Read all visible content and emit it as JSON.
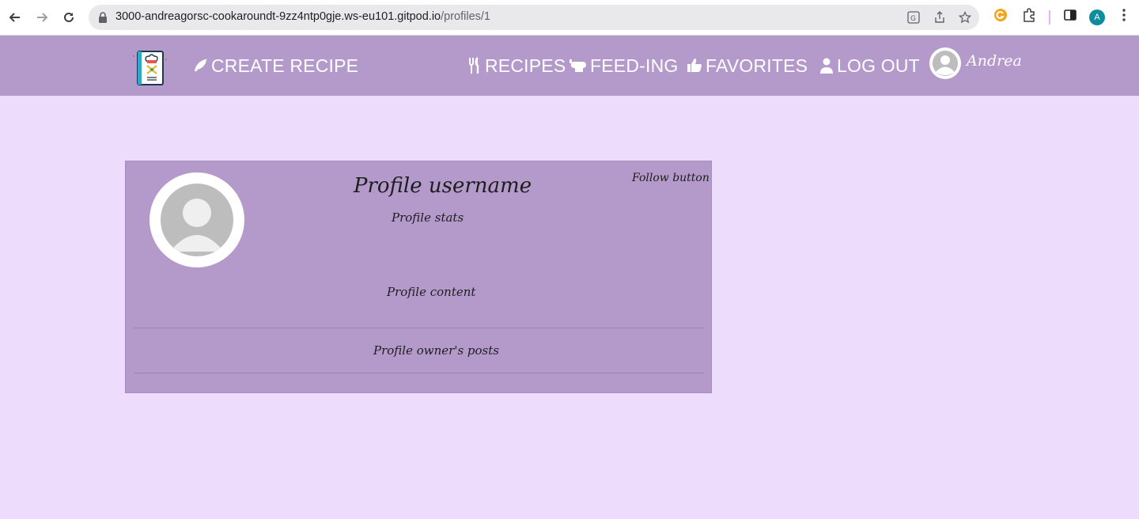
{
  "browser": {
    "url_host": "3000-andreagorsc-cookaroundt-9zz4ntp0gje.ws-eu101.gitpod.io",
    "url_path": "/profiles/1",
    "profile_initial": "A"
  },
  "navbar": {
    "create_recipe": "CREATE RECIPE",
    "recipes": "RECIPES",
    "feed": "FEED-ING",
    "favorites": "FAVORITES",
    "logout": "LOG OUT",
    "username": "Andrea"
  },
  "profile": {
    "username": "Profile username",
    "stats": "Profile stats",
    "follow_button": "Follow button",
    "content": "Profile content",
    "posts": "Profile owner's posts"
  },
  "colors": {
    "page_background": "#eedcfd",
    "navbar_background": "#b49acb",
    "card_background": "#b49acb"
  }
}
